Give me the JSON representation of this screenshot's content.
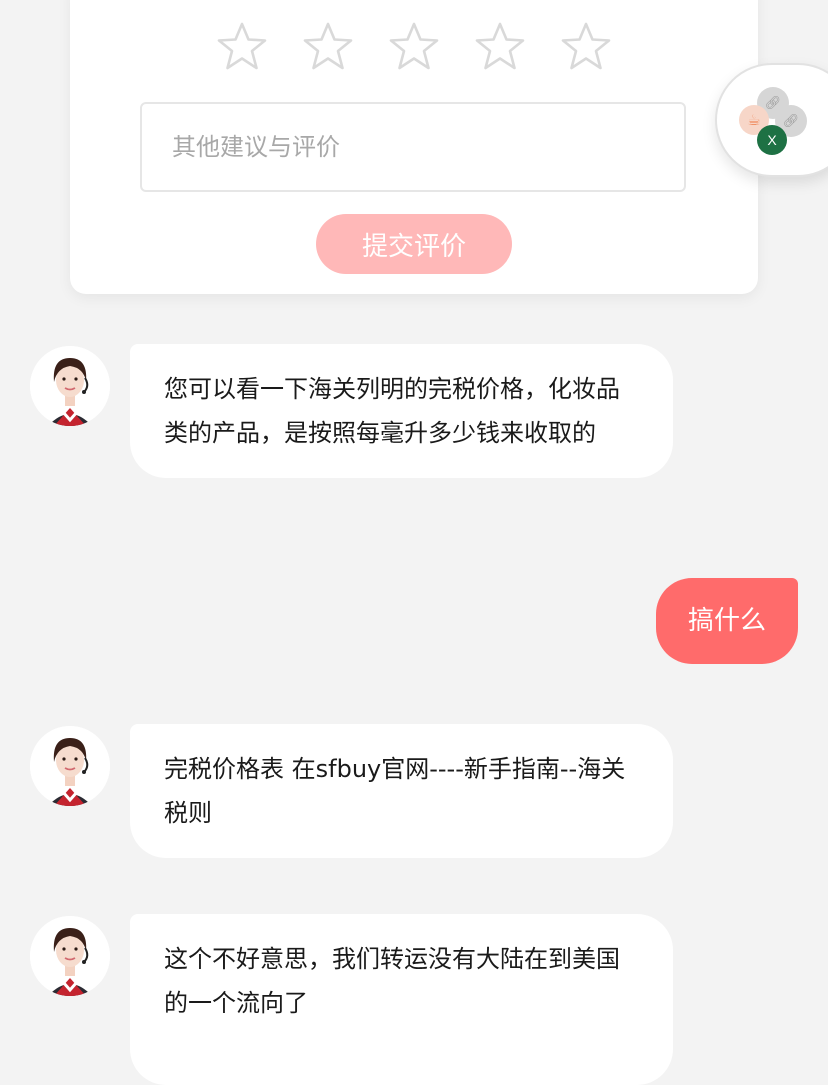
{
  "rating": {
    "stars_total": 5,
    "stars_selected": 0,
    "comment_placeholder": "其他建议与评价",
    "submit_label": "提交评价",
    "star_outline_color": "#d9d9d9",
    "submit_color": "#ffb8b8"
  },
  "floating_widget": {
    "icons": [
      "link-icon",
      "link-icon",
      "cup-icon",
      "excel-icon"
    ],
    "excel_label": "X"
  },
  "messages": [
    {
      "from": "agent",
      "text": "您可以看一下海关列明的完税价格，化妆品类的产品，是按照每毫升多少钱来收取的"
    },
    {
      "from": "user",
      "text": "搞什么"
    },
    {
      "from": "agent",
      "text": "完税价格表 在sfbuy官网----新手指南--海关税则"
    },
    {
      "from": "agent",
      "text": "这个不好意思，我们转运没有大陆在到美国的一个流向了"
    }
  ],
  "colors": {
    "background": "#f3f3f3",
    "user_bubble": "#ff6b6b",
    "agent_bubble": "#ffffff"
  }
}
